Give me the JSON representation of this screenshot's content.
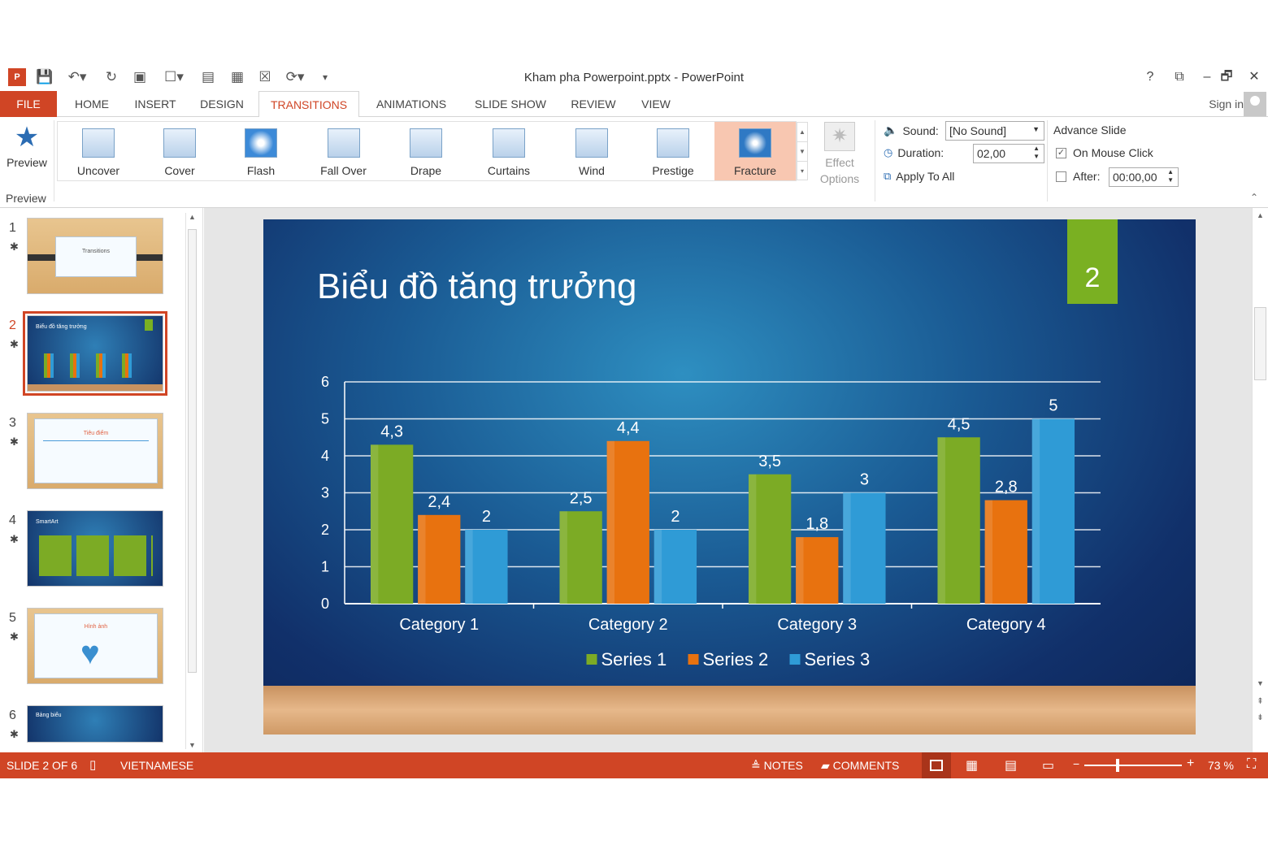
{
  "window": {
    "title": "Kham pha Powerpoint.pptx - PowerPoint",
    "help": "?",
    "minimize": "–",
    "restore": "🗗",
    "close": "✕"
  },
  "tabs": [
    {
      "label": "FILE"
    },
    {
      "label": "HOME"
    },
    {
      "label": "INSERT"
    },
    {
      "label": "DESIGN"
    },
    {
      "label": "TRANSITIONS"
    },
    {
      "label": "ANIMATIONS"
    },
    {
      "label": "SLIDE SHOW"
    },
    {
      "label": "REVIEW"
    },
    {
      "label": "VIEW"
    }
  ],
  "signin": "Sign in",
  "ribbon": {
    "preview_button": "Preview",
    "preview_group": "Preview",
    "transitions": [
      {
        "label": "Uncover"
      },
      {
        "label": "Cover"
      },
      {
        "label": "Flash"
      },
      {
        "label": "Fall Over"
      },
      {
        "label": "Drape"
      },
      {
        "label": "Curtains"
      },
      {
        "label": "Wind"
      },
      {
        "label": "Prestige"
      },
      {
        "label": "Fracture"
      }
    ],
    "effect_options_1": "Effect",
    "effect_options_2": "Options",
    "sound_label": "Sound:",
    "sound_value": "[No Sound]",
    "duration_label": "Duration:",
    "duration_value": "02,00",
    "apply_all": "Apply To All",
    "advance_title": "Advance Slide",
    "on_mouse_click": "On Mouse Click",
    "after_label": "After:",
    "after_value": "00:00,00"
  },
  "thumbnails": [
    {
      "num": "1",
      "title": "Transitions"
    },
    {
      "num": "2",
      "title": "Biểu đồ tăng trưởng"
    },
    {
      "num": "3",
      "title": "Tiêu điểm"
    },
    {
      "num": "4",
      "title": "SmartArt"
    },
    {
      "num": "5",
      "title": "Hình ảnh"
    },
    {
      "num": "6",
      "title": "Bảng biểu"
    }
  ],
  "slide": {
    "title": "Biểu đồ tăng trưởng",
    "number": "2"
  },
  "chart_data": {
    "type": "bar",
    "categories": [
      "Category 1",
      "Category 2",
      "Category 3",
      "Category 4"
    ],
    "series": [
      {
        "name": "Series 1",
        "values": [
          4.3,
          2.5,
          3.5,
          4.5
        ],
        "labels": [
          "4,3",
          "2,5",
          "3,5",
          "4,5"
        ],
        "color": "#7cab25"
      },
      {
        "name": "Series 2",
        "values": [
          2.4,
          4.4,
          1.8,
          2.8
        ],
        "labels": [
          "2,4",
          "4,4",
          "1,8",
          "2,8"
        ],
        "color": "#e8720f"
      },
      {
        "name": "Series 3",
        "values": [
          2,
          2,
          3,
          5
        ],
        "labels": [
          "2",
          "2",
          "3",
          "5"
        ],
        "color": "#2f9bd6"
      }
    ],
    "yticks": [
      "0",
      "1",
      "2",
      "3",
      "4",
      "5",
      "6"
    ],
    "ylim": [
      0,
      6
    ],
    "grid": true,
    "legend": "bottom"
  },
  "status": {
    "slide_of": "SLIDE 2 OF 6",
    "language": "VIETNAMESE",
    "notes": "NOTES",
    "comments": "COMMENTS",
    "zoom": "73 %"
  },
  "colors": {
    "accent": "#d04525",
    "selected_transition": "#f8c7b1"
  }
}
